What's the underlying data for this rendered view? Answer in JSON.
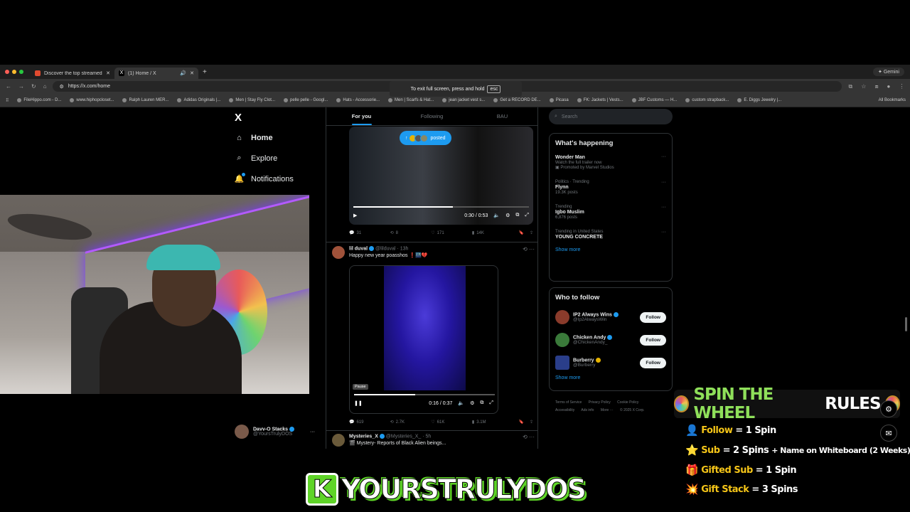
{
  "browser": {
    "tabs": [
      {
        "title": "Discover the top streamed m",
        "favicon_color": "#e04a2f",
        "active": false
      },
      {
        "title": "(1) Home / X",
        "favicon_color": "#ffffff",
        "active": true
      }
    ],
    "gemini_label": "Gemini",
    "url": "https://x.com/home",
    "fullscreen_toast": "To exit full screen, press and hold",
    "fullscreen_key": "esc",
    "bookmarks": [
      "FileHippo.com - D...",
      "www.hiphopcloset...",
      "Ralph Lauren MER...",
      "Adidas Originals |...",
      "Men | Stay Fly Clot...",
      "pelle pelle - Googl...",
      "Hats - Accessorie...",
      "Men | Scarfs & Hat...",
      "jean jacket vest s...",
      "Get a RECORD DE...",
      "Picasa",
      "FK: Jackets | Vests...",
      "JBF Customs — H...",
      "custom strapback...",
      "E. Diggs Jewelry |..."
    ],
    "all_bookmarks": "All Bookmarks"
  },
  "x_nav": {
    "logo": "X",
    "items": [
      {
        "label": "Home",
        "icon": "home-icon"
      },
      {
        "label": "Explore",
        "icon": "search-icon"
      },
      {
        "label": "Notifications",
        "icon": "bell-icon"
      }
    ],
    "profile": {
      "name": "Davv-O Stacks",
      "handle": "@YoursTrulyDOS",
      "more": "···"
    }
  },
  "timeline": {
    "tabs": [
      "For you",
      "Following",
      "BAU"
    ],
    "posted_pill": "posted",
    "video1": {
      "time": "0:30 / 0:53",
      "progress": 0.566
    },
    "post1_actions": {
      "replies": "31",
      "reposts": "8",
      "likes": "171",
      "views": "14K"
    },
    "post2": {
      "name": "lil duval",
      "handle": "@lilduval",
      "time": "· 13h",
      "text": "Happy new year poasshos ❗🌃💔",
      "video": {
        "pause_badge": "Pause",
        "time": "0:16 / 0:37",
        "progress": 0.432
      },
      "actions": {
        "replies": "619",
        "reposts": "2.7K",
        "likes": "61K",
        "views": "3.1M"
      }
    },
    "post3": {
      "name": "Mysteries_X",
      "handle": "@Mysteries_X_",
      "time": "· 5h",
      "text": "🎬 Mystery- Reports of Black Alien beings..."
    }
  },
  "sidebar": {
    "search_placeholder": "Search",
    "happening_title": "What's happening",
    "trends": [
      {
        "context": "",
        "title": "Wonder Man",
        "meta": "Watch the full trailer now",
        "promo": "Promoted by Marvel Studios"
      },
      {
        "context": "Politics · Trending",
        "title": "Flynn",
        "meta": "19.3K posts",
        "promo": ""
      },
      {
        "context": "Trending",
        "title": "Igbo Muslim",
        "meta": "6,876 posts",
        "promo": ""
      },
      {
        "context": "Trending in United States",
        "title": "YOUNG CONCRETE",
        "meta": "",
        "promo": ""
      }
    ],
    "show_more": "Show more",
    "who_to_follow_title": "Who to follow",
    "follow_suggestions": [
      {
        "name": "IP2 Always Wins",
        "handle": "@Ip2AlwaysWin",
        "badge": "blue",
        "avatar_color": "#8a3b2b"
      },
      {
        "name": "Chicken Andy",
        "handle": "@ChickenAndy_",
        "badge": "blue",
        "avatar_color": "#3a7a3a"
      },
      {
        "name": "Burberry",
        "handle": "@Burberry",
        "badge": "gold",
        "avatar_color": "#2a3e8a"
      }
    ],
    "follow_button": "Follow",
    "footer": [
      "Terms of Service",
      "Privacy Policy",
      "Cookie Policy",
      "Accessibility",
      "Ads info",
      "More ···",
      "© 2025 X Corp."
    ]
  },
  "overlay": {
    "rules_title_a": "SPIN THE WHEEL",
    "rules_title_b": "RULES",
    "rules": [
      {
        "icon": "👤",
        "action": "Follow",
        "result": " = 1 Spin",
        "extra": ""
      },
      {
        "icon": "⭐",
        "action": "Sub",
        "result": " = 2 Spins",
        "extra": " + Name on Whiteboard (2 Weeks)"
      },
      {
        "icon": "🎁",
        "action": "Gifted Sub",
        "result": " = 1 Spin",
        "extra": ""
      },
      {
        "icon": "💥",
        "action": "Gift Stack",
        "result": " = 3 Spins",
        "extra": ""
      }
    ],
    "brand_letter": "K",
    "brand_name": "YOURSTRULYDOS"
  }
}
